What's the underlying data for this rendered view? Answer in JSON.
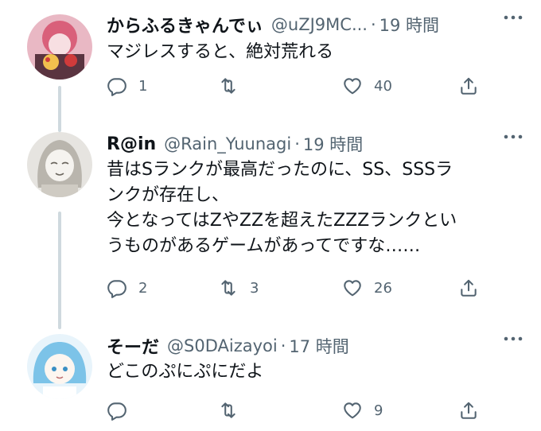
{
  "tweets": [
    {
      "name": "からふるきゃんでぃ",
      "handle": "@uZJ9MC...",
      "separator": "·",
      "time": "19 時間",
      "text_lines": [
        "マジレスすると、絶対荒れる"
      ],
      "actions": {
        "reply": "1",
        "retweet": "",
        "like": "40"
      }
    },
    {
      "name": "R@in",
      "handle": "@Rain_Yuunagi",
      "separator": "·",
      "time": "19 時間",
      "text_lines": [
        "昔はSランクが最高だったのに、SS、SSSラ",
        "ンクが存在し、",
        "今となってはZやZZを超えたZZZランクとい",
        "うものがあるゲームがあってですな……"
      ],
      "actions": {
        "reply": "2",
        "retweet": "3",
        "like": "26"
      }
    },
    {
      "name": "そーだ",
      "handle": "@S0DAizayoi",
      "separator": "·",
      "time": "17 時間",
      "text_lines": [
        "どこのぷにぷにだよ"
      ],
      "actions": {
        "reply": "",
        "retweet": "",
        "like": "9"
      }
    }
  ],
  "colors": {
    "text": "#0f1419",
    "secondary": "#536471",
    "thread_line": "#cfd9de"
  },
  "icons": [
    "reply-icon",
    "retweet-icon",
    "like-icon",
    "share-icon",
    "more-icon"
  ]
}
